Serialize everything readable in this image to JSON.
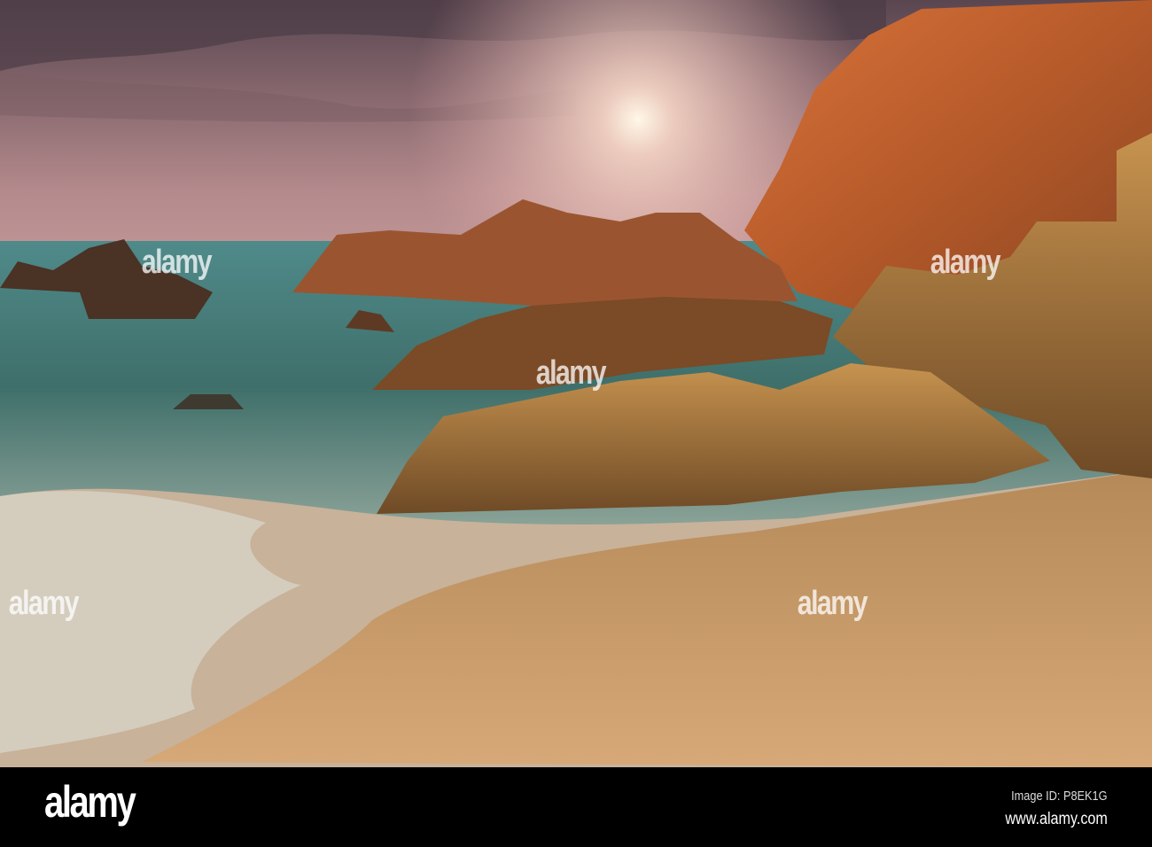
{
  "photo": {
    "description_alt": "Rocky beach at sunset"
  },
  "watermark": {
    "text": "alamy"
  },
  "footer": {
    "logo": "alamy",
    "image_id": "Image ID: P8EK1G",
    "website": "www.alamy.com"
  }
}
